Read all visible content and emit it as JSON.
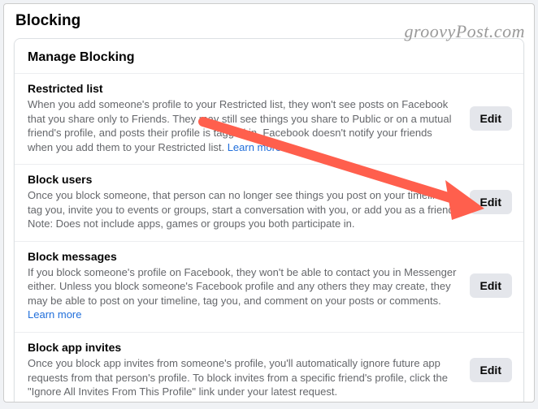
{
  "page": {
    "title": "Blocking",
    "card_header": "Manage Blocking"
  },
  "sections": [
    {
      "title": "Restricted list",
      "desc_parts": [
        "When you add someone's profile to your Restricted list, they won't see posts on Facebook that you share only to Friends. They may still see things you share to Public or on a mutual friend's profile, and posts their profile is tagged in. Facebook doesn't notify your friends when you add them to your Restricted list. "
      ],
      "learn_more": "Learn more",
      "edit": "Edit"
    },
    {
      "title": "Block users",
      "desc_parts": [
        "Once you block someone, that person can no longer see things you post on your timeline, tag you, invite you to events or groups, start a conversation with you, or add you as a friend. Note: Does not include apps, games or groups you both participate in."
      ],
      "learn_more": "",
      "edit": "Edit"
    },
    {
      "title": "Block messages",
      "desc_parts": [
        "If you block someone's profile on Facebook, they won't be able to contact you in Messenger either. Unless you block someone's Facebook profile and any others they may create, they may be able to post on your timeline, tag you, and comment on your posts or comments. "
      ],
      "learn_more": "Learn more",
      "edit": "Edit"
    },
    {
      "title": "Block app invites",
      "desc_parts": [
        "Once you block app invites from someone's profile, you'll automatically ignore future app requests from that person's profile. To block invites from a specific friend's profile, click the \"Ignore All Invites From This Profile\" link under your latest request."
      ],
      "learn_more": "",
      "edit": "Edit"
    }
  ],
  "watermark": "groovyPost.com",
  "arrow": {
    "color": "#ff5f4d"
  }
}
